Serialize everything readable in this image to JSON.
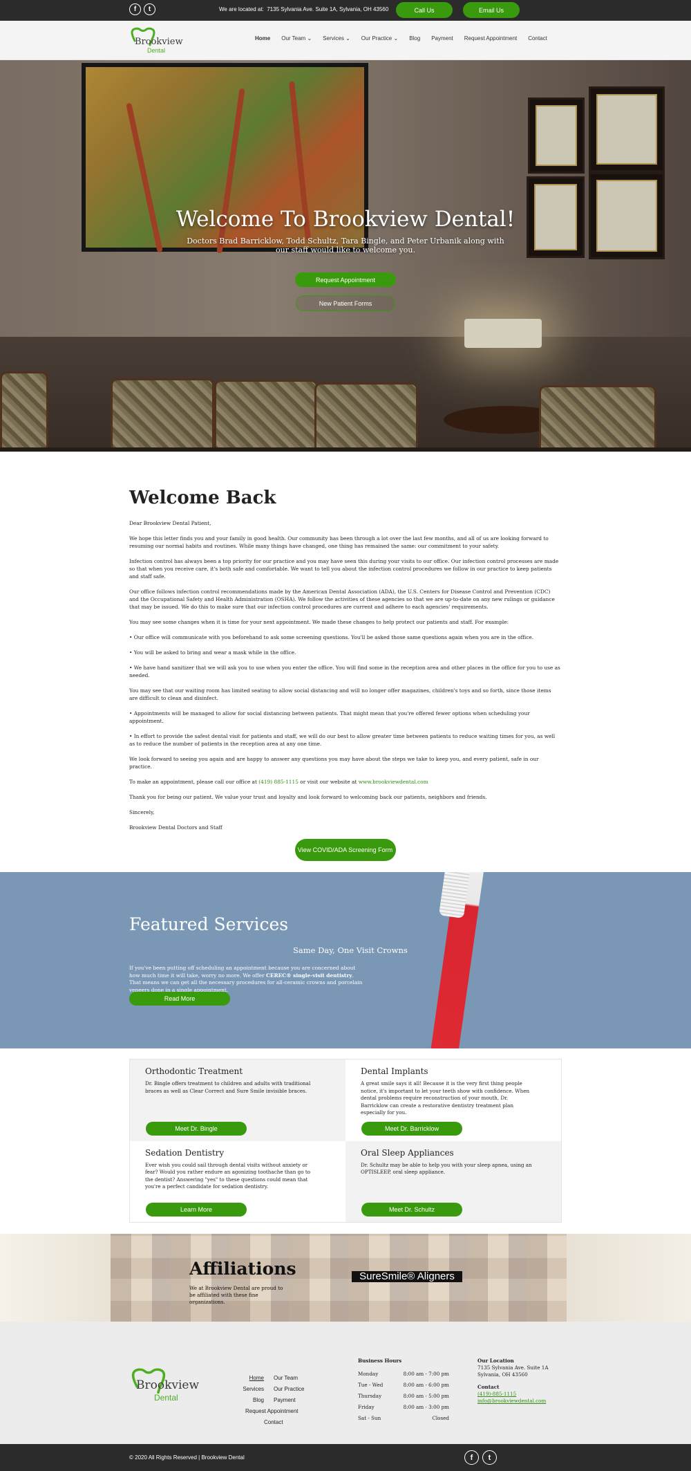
{
  "topbar": {
    "location_prefix": "We are located at:",
    "location": "7135 Sylvania Ave. Suite 1A, Sylvania, OH 43560",
    "call_label": "Call Us",
    "email_label": "Email Us",
    "social": [
      "facebook-icon",
      "twitter-icon"
    ]
  },
  "header": {
    "logo_name": "Brookview",
    "logo_sub": "Dental",
    "nav": [
      {
        "label": "Home",
        "active": true
      },
      {
        "label": "Our Team",
        "dropdown": true
      },
      {
        "label": "Services",
        "dropdown": true
      },
      {
        "label": "Our Practice",
        "dropdown": true
      },
      {
        "label": "Blog"
      },
      {
        "label": "Payment"
      },
      {
        "label": "Request Appointment"
      },
      {
        "label": "Contact"
      }
    ]
  },
  "hero": {
    "title": "Welcome To Brookview Dental!",
    "lead": "Doctors Brad Barricklow, Todd Schultz, Tara Bingle, and Peter Urbanik along with our staff would like to welcome you.",
    "primary_button": "Request Appointment",
    "secondary_button": "New Patient Forms"
  },
  "welcome": {
    "title": "Welcome Back",
    "salutation": "Dear Brookview Dental Patient,",
    "p1": "We hope this letter finds you and your family in good health. Our community has been through a lot over the last few months, and all of us are looking forward to resuming our normal habits and routines. While many things have changed, one thing has remained the same: our commitment to your safety.",
    "p2": "Infection control has always been a top priority for our practice and you may have seen this during your visits to our office. Our infection control processes are made so that when you receive care, it's both safe and comfortable. We want to tell you about the infection control procedures we follow in our practice to keep patients and staff safe.",
    "p3": "Our office follows infection control recommendations made by the American Dental Association (ADA), the U.S. Centers for Disease Control and Prevention (CDC) and the Occupational Safety and Health Administration (OSHA). We follow the activities of these agencies so that we are up-to-date on any new rulings or guidance that may be issued. We do this to make sure that our infection control procedures are current and adhere to each agencies' requirements.",
    "p4": "You may see some changes when it is time for your next appointment. We made these changes to help protect our patients and staff. For example:",
    "b1": "• Our office will communicate with you beforehand to ask some screening questions. You'll be asked those same questions again when you are in the office.",
    "b2": "• You will be asked to bring and wear a mask while in the office.",
    "b3": "• We have hand sanitizer that we will ask you to use when you enter the office. You will find some in the reception area and other places in the office for you to use as needed.",
    "p5": "You may see that our waiting room has limited seating to allow social distancing and will no longer offer magazines, children's toys and so forth, since those items are difficult to clean and disinfect.",
    "b4": "• Appointments will be managed to allow for social distancing between patients. That might mean that you're offered fewer options when scheduling your appointment.",
    "b5": "• In effort to provide the safest dental visit for patients and staff, we will do our best to allow greater time between patients to reduce waiting times for you, as well as to reduce the number of patients in the reception area at any one time.",
    "p6": "We look forward to seeing you again and are happy to answer any questions you may have about the steps we take to keep you, and every patient, safe in our practice.",
    "p7_before": "To make an appointment, please call our office at ",
    "phone": "(419) 885-1115",
    "p7_mid": " or visit our website at ",
    "website": "www.brookviewdental.com",
    "p8": "Thank you for being our patient. We value your trust and loyalty and look forward to welcoming back our patients, neighbors and friends.",
    "closing": "Sincerely,",
    "signature": "Brookview Dental Doctors and Staff",
    "screening_button": "View COVID/ADA Screening Form"
  },
  "featured": {
    "title": "Featured Services",
    "subtitle": "Same Day, One Visit Crowns",
    "text_before": "If you've been putting off scheduling an appointment because you are concerned about how much time it will take, worry no more. We offer ",
    "text_bold": "CEREC® single-visit dentistry",
    "text_after": ". That means we can get all the necessary procedures for all-ceramic crowns and porcelain veneers done in a single appointment.",
    "button": "Read More"
  },
  "services": [
    {
      "title": "Orthodontic Treatment",
      "text": "Dr. Bingle offers treatment to children and adults with traditional braces as well as Clear Correct and Sure Smile invisible braces.",
      "button": "Meet Dr. Bingle"
    },
    {
      "title": "Dental Implants",
      "text": "A great smile says it all! Because it is the very first thing people notice, it's important to let your teeth show with confidence. When dental problems require reconstruction of your mouth, Dr. Barricklow can create a restorative dentistry treatment plan especially for you.",
      "button": "Meet Dr. Barricklow"
    },
    {
      "title": "Sedation Dentistry",
      "text": "Ever wish you could sail through dental visits without anxiety or fear? Would you rather endure an agonizing toothache than go to the dentist? Answering \"yes\" to these questions could mean that you're a perfect candidate for sedation dentistry.",
      "button": "Learn More"
    },
    {
      "title": "Oral Sleep Appliances",
      "text": "Dr. Schultz may be able to help you with your sleep apnea, using an OPTISLEEP, oral sleep appliance.",
      "button": "Meet Dr. Schultz"
    }
  ],
  "affiliations": {
    "title": "Affiliations",
    "text": "We at Brookview Dental are proud to be affiliated with these fine organizations.",
    "logo_text": "SureSmile® Aligners"
  },
  "footer": {
    "logo_name": "Brookview",
    "logo_sub": "Dental",
    "links_col1": [
      "Home",
      "Services",
      "Blog"
    ],
    "links_col2": [
      "Our Team",
      "Our Practice",
      "Payment"
    ],
    "links_extra": [
      "Request Appointment",
      "Contact"
    ],
    "hours_title": "Business Hours",
    "hours": [
      {
        "day": "Monday",
        "time": "8:00 am - 7:00 pm"
      },
      {
        "day": "Tue - Wed",
        "time": "8:00 am - 6:00 pm"
      },
      {
        "day": "Thursday",
        "time": "8:00 am - 5:00 pm"
      },
      {
        "day": "Friday",
        "time": "8:00 am - 3:00 pm"
      },
      {
        "day": "Sat - Sun",
        "time": "Closed"
      }
    ],
    "location_title": "Our Location",
    "address1": "7135 Sylvania Ave. Suite 1A",
    "address2": "Sylvania, OH 43560",
    "contact_title": "Contact",
    "phone": "(419)-885-1115",
    "email": "info@brookviewdental.com"
  },
  "copyright": "© 2020 All Rights Reserved | Brookview Dental",
  "colors": {
    "accent": "#3a9a0e",
    "dark": "#2b2b2b",
    "featured_bg": "#7a98b6"
  }
}
